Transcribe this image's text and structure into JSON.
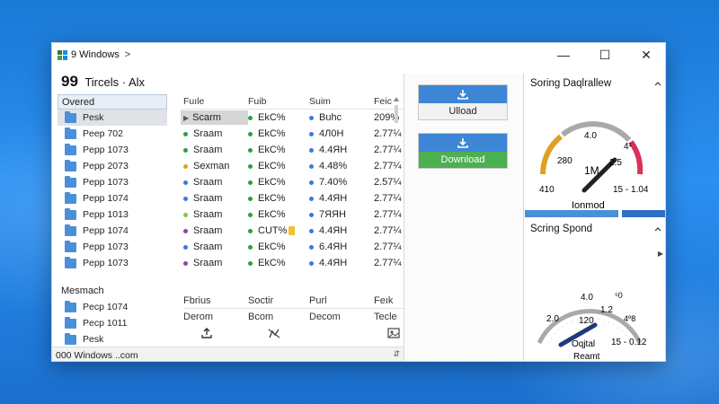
{
  "window": {
    "title": "9 Windows",
    "crumb_sep": ">",
    "controls": {
      "minimize": "—",
      "maximize": "☐",
      "close": "✕"
    }
  },
  "pathbar": {
    "number": "99",
    "text": "Tircels · Alx"
  },
  "nav": {
    "header": "Overed",
    "items": [
      {
        "label": "Pesk",
        "selected": true
      },
      {
        "label": "Peep 702"
      },
      {
        "label": "Pepp 1073"
      },
      {
        "label": "Pepp 2073"
      },
      {
        "label": "Pepp 1073"
      },
      {
        "label": "Pepp 1074"
      },
      {
        "label": "Pepp 1013"
      },
      {
        "label": "Pepp 1074"
      },
      {
        "label": "Pepp 1073"
      },
      {
        "label": "Pepp 1073"
      }
    ],
    "section2": "Mesmach",
    "items2": [
      {
        "label": "Pecp 1074"
      },
      {
        "label": "Pecp 1011"
      },
      {
        "label": "Pesk"
      }
    ]
  },
  "table": {
    "headers": [
      "Fuıle",
      "Fuib",
      "Suim",
      "Feic"
    ],
    "rows": [
      {
        "c1": "Scarm",
        "c1_marker": "arrow",
        "c2": "EkC%",
        "c2_dot": "#2e9e3e",
        "c3": "Buhc",
        "c3_dot": "#3a7bd5",
        "c4": "209%",
        "highlight": true
      },
      {
        "c1": "Sraam",
        "c1_dot": "#2e9e3e",
        "c2": "EkC%",
        "c2_dot": "#2e9e3e",
        "c3": "4Л0H",
        "c3_dot": "#3a7bd5",
        "c4": "2.77¼"
      },
      {
        "c1": "Sraam",
        "c1_dot": "#2e9e3e",
        "c2": "EkC%",
        "c2_dot": "#2e9e3e",
        "c3": "4.4ЯH",
        "c3_dot": "#3a7bd5",
        "c4": "2.77¼"
      },
      {
        "c1": "Sexman",
        "c1_dot": "#e0a020",
        "c2": "EkC%",
        "c2_dot": "#2e9e3e",
        "c3": "4.48%",
        "c3_dot": "#3a7bd5",
        "c4": "2.77¼"
      },
      {
        "c1": "Sraam",
        "c1_dot": "#3a7bd5",
        "c2": "EkC%",
        "c2_dot": "#2e9e3e",
        "c3": "7.40%",
        "c3_dot": "#3a7bd5",
        "c4": "2.57¼"
      },
      {
        "c1": "Sraam",
        "c1_dot": "#3a7bd5",
        "c2": "EkC%",
        "c2_dot": "#2e9e3e",
        "c3": "4.4ЯH",
        "c3_dot": "#3a7bd5",
        "c4": "2.77¼"
      },
      {
        "c1": "Sraam",
        "c1_dot": "#8bc34a",
        "c2": "EkC%",
        "c2_dot": "#2e9e3e",
        "c3": "7ЯЯH",
        "c3_dot": "#3a7bd5",
        "c4": "2.77¼"
      },
      {
        "c1": "Sraam",
        "c1_dot": "#8e44ad",
        "c2": "CUT%",
        "c2_dot": "#2e9e3e",
        "c2_tag": true,
        "c3": "4.4ЯH",
        "c3_dot": "#3a7bd5",
        "c4": "2.77¼"
      },
      {
        "c1": "Sraam",
        "c1_dot": "#3a7bd5",
        "c2": "EkC%",
        "c2_dot": "#2e9e3e",
        "c3": "6.4ЯH",
        "c3_dot": "#3a7bd5",
        "c4": "2.77¼"
      },
      {
        "c1": "Sraam",
        "c1_dot": "#8e44ad",
        "c2": "EkC%",
        "c2_dot": "#2e9e3e",
        "c3": "4.4ЯH",
        "c3_dot": "#3a7bd5",
        "c4": "2.77¼"
      }
    ]
  },
  "subtable": {
    "headers": [
      "Fbrius",
      "Soctir",
      "Purl",
      "Feık"
    ],
    "values": [
      "Derom",
      "Bcom",
      "Decom",
      "Tecle"
    ],
    "icons": [
      "upload-icon",
      "edit-icon",
      "image-icon"
    ]
  },
  "actions": {
    "upload_label": "Ulload",
    "download_label": "Download"
  },
  "gauge1": {
    "title": "Soring Daqlrallew",
    "ticks": [
      "280",
      "4.0",
      "4¹",
      "410",
      "2.5"
    ],
    "center_value": "1M",
    "range": "15 - 1.04",
    "caption": "Ionmod",
    "level": 0.62
  },
  "gauge2": {
    "title": "Scring Spond",
    "ticks": [
      "2.0",
      "4.0",
      "1.2",
      "⁵0",
      "120",
      "4º8",
      "15 - 0.12"
    ],
    "caption1": "Oqjtal",
    "caption2": "Reamt",
    "level": 0.2
  },
  "statusbar": {
    "text": "000 Windows ..com",
    "scroll_icon": "⇵"
  },
  "colors": {
    "accent_blue": "#3d86d6",
    "green": "#4caf50",
    "gauge_orange": "#e0a020",
    "gauge_red": "#d9325a",
    "gauge_gray": "#a9a9a9"
  }
}
